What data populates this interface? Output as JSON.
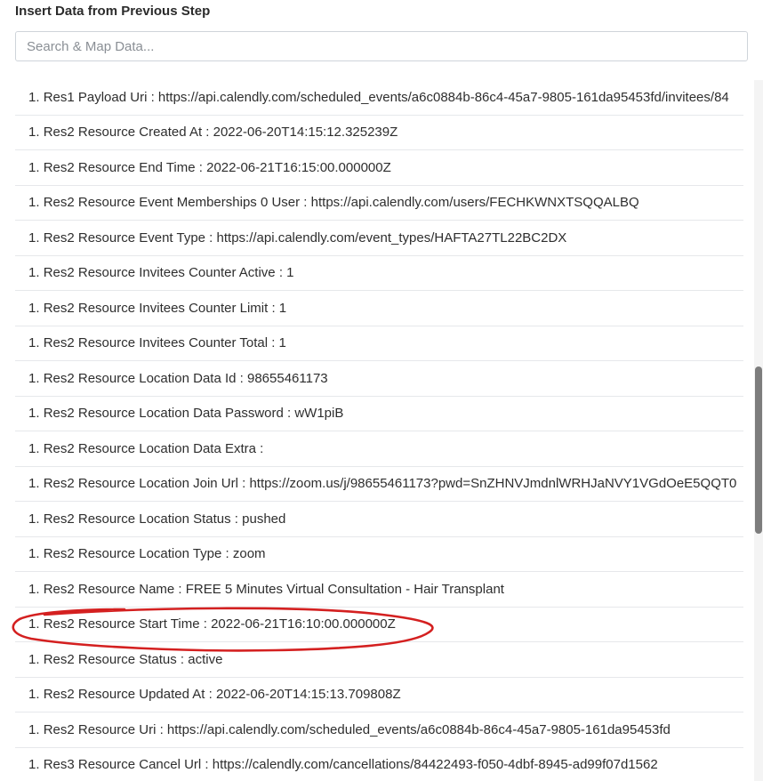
{
  "panel": {
    "title": "Insert Data from Previous Step"
  },
  "search": {
    "placeholder": "Search & Map Data..."
  },
  "items": [
    {
      "prefix": "1. ",
      "label": "Res1 Payload Uri : https://api.calendly.com/scheduled_events/a6c0884b-86c4-45a7-9805-161da95453fd/invitees/84"
    },
    {
      "prefix": "1. ",
      "label": "Res2 Resource Created At : 2022-06-20T14:15:12.325239Z"
    },
    {
      "prefix": "1. ",
      "label": "Res2 Resource End Time : 2022-06-21T16:15:00.000000Z"
    },
    {
      "prefix": "1. ",
      "label": "Res2 Resource Event Memberships 0 User : https://api.calendly.com/users/FECHKWNXTSQQALBQ"
    },
    {
      "prefix": "1. ",
      "label": "Res2 Resource Event Type : https://api.calendly.com/event_types/HAFTA27TL22BC2DX"
    },
    {
      "prefix": "1. ",
      "label": "Res2 Resource Invitees Counter Active : 1"
    },
    {
      "prefix": "1. ",
      "label": "Res2 Resource Invitees Counter Limit : 1"
    },
    {
      "prefix": "1. ",
      "label": "Res2 Resource Invitees Counter Total : 1"
    },
    {
      "prefix": "1. ",
      "label": "Res2 Resource Location Data Id : 98655461173"
    },
    {
      "prefix": "1. ",
      "label": "Res2 Resource Location Data Password : wW1piB"
    },
    {
      "prefix": "1. ",
      "label": "Res2 Resource Location Data Extra :"
    },
    {
      "prefix": "1. ",
      "label": "Res2 Resource Location Join Url : https://zoom.us/j/98655461173?pwd=SnZHNVJmdnlWRHJaNVY1VGdOeE5QQT0"
    },
    {
      "prefix": "1. ",
      "label": "Res2 Resource Location Status : pushed"
    },
    {
      "prefix": "1. ",
      "label": "Res2 Resource Location Type : zoom"
    },
    {
      "prefix": "1. ",
      "label": "Res2 Resource Name : FREE 5 Minutes Virtual Consultation - Hair Transplant"
    },
    {
      "prefix": "1. ",
      "label": "Res2 Resource Start Time : 2022-06-21T16:10:00.000000Z"
    },
    {
      "prefix": "1. ",
      "label": "Res2 Resource Status : active"
    },
    {
      "prefix": "1. ",
      "label": "Res2 Resource Updated At : 2022-06-20T14:15:13.709808Z"
    },
    {
      "prefix": "1. ",
      "label": "Res2 Resource Uri : https://api.calendly.com/scheduled_events/a6c0884b-86c4-45a7-9805-161da95453fd"
    },
    {
      "prefix": "1. ",
      "label": "Res3 Resource Cancel Url : https://calendly.com/cancellations/84422493-f050-4dbf-8945-ad99f07d1562"
    }
  ],
  "colors": {
    "annotation": "#d42020",
    "scrollbar_thumb": "#7d7d7d",
    "divider": "#e6e8eb"
  }
}
